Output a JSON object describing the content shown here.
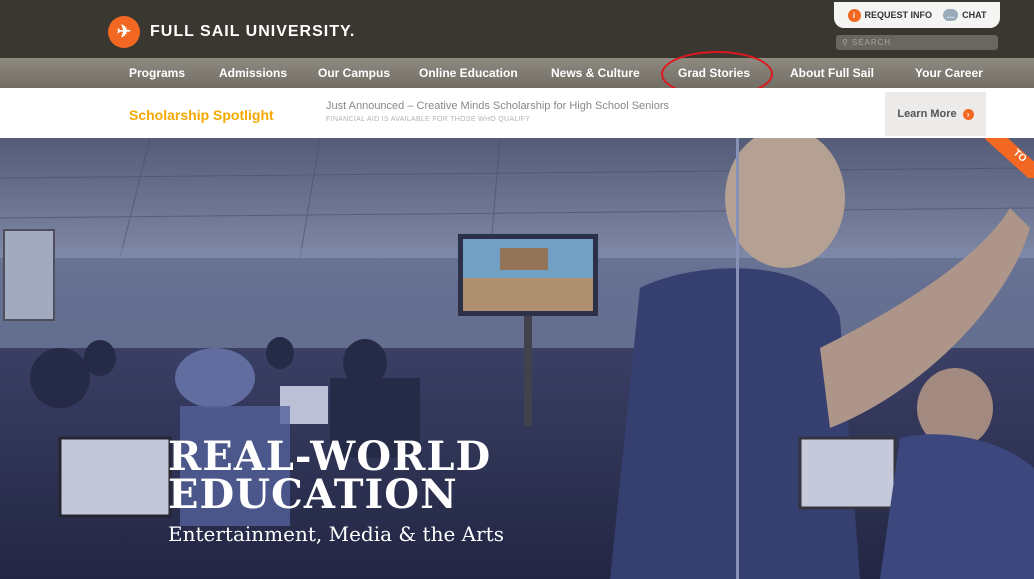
{
  "header": {
    "brand": "FULL SAIL UNIVERSITY.",
    "request_info": "REQUEST INFO",
    "chat": "CHAT",
    "search_placeholder": "SEARCH"
  },
  "nav": {
    "items": [
      {
        "label": "Programs"
      },
      {
        "label": "Admissions"
      },
      {
        "label": "Our Campus"
      },
      {
        "label": "Online Education"
      },
      {
        "label": "News & Culture"
      },
      {
        "label": "Grad Stories"
      },
      {
        "label": "About Full Sail"
      },
      {
        "label": "Your Career"
      }
    ]
  },
  "spotlight": {
    "title": "Scholarship Spotlight",
    "headline": "Just Announced – Creative Minds Scholarship for High School Seniors",
    "subline": "FINANCIAL AID IS AVAILABLE FOR THOSE WHO QUALIFY",
    "cta": "Learn More"
  },
  "hero": {
    "title_line1": "REAL-WORLD",
    "title_line2": "EDUCATION",
    "subtitle": "Entertainment, Media & the Arts",
    "corner_tag": "TO"
  },
  "colors": {
    "accent": "#f26722",
    "header_bg": "#3a3630",
    "nav_bg": "#7f7b72",
    "spotlight_title": "#f6a800",
    "highlight_circle": "#e0161b"
  }
}
